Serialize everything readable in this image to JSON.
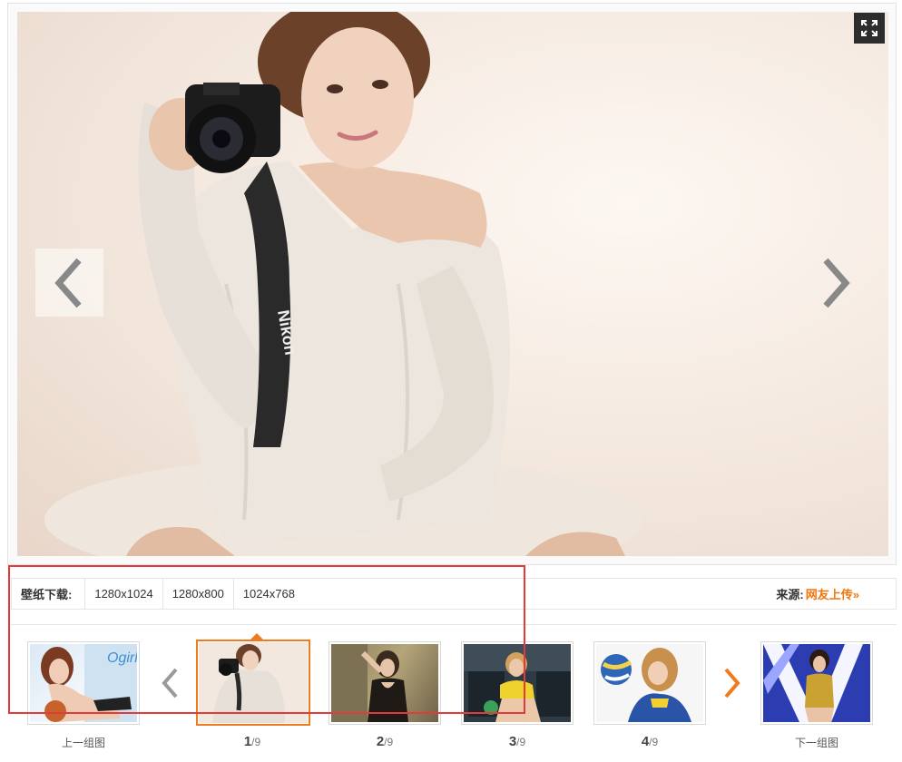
{
  "viewer": {
    "fullscreen_icon": "expand-icon",
    "prev_icon": "chevron-left-icon",
    "next_icon": "chevron-right-icon",
    "photo_text": "Nikon"
  },
  "download": {
    "label": "壁纸下载:",
    "sizes": [
      "1280x1024",
      "1280x800",
      "1024x768"
    ],
    "source_label": "来源:",
    "source_link": "网友上传»"
  },
  "strip": {
    "prev_group": "上一组图",
    "next_group": "下一组图",
    "total": "9",
    "pages": [
      "1",
      "2",
      "3",
      "4"
    ],
    "separator": "/",
    "prev_thumb_text": "Ogirl"
  },
  "colors": {
    "accent": "#f07b1c",
    "annotation": "#e33b3b"
  }
}
